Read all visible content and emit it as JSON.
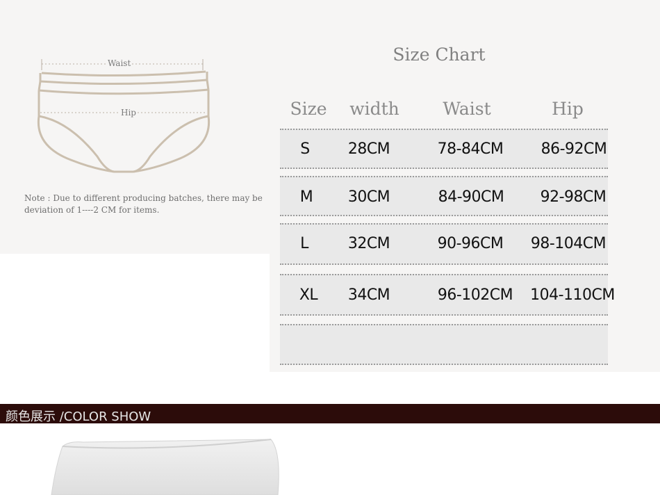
{
  "diagram": {
    "waist_label": "Waist",
    "hip_label": "Hip"
  },
  "note": "Note : Due to different producing batches, there may be deviation of 1----2 CM for items.",
  "size_chart": {
    "title": "Size Chart",
    "headers": [
      "Size",
      "width",
      "Waist",
      "Hip"
    ],
    "rows": [
      [
        "S",
        "28CM",
        "78-84CM",
        "86-92CM"
      ],
      [
        "M",
        "30CM",
        "84-90CM",
        "92-98CM"
      ],
      [
        "L",
        "32CM",
        "90-96CM",
        "98-104CM"
      ],
      [
        "XL",
        "34CM",
        "96-102CM",
        "104-110CM"
      ]
    ]
  },
  "color_show": {
    "label": "颜色展示 /COLOR SHOW"
  },
  "colors": {
    "panel_bg": "#f6f5f4",
    "row_band": "#e9e9e9",
    "bar_bg": "#2c0c0a",
    "garment_line": "#cbbfae"
  }
}
